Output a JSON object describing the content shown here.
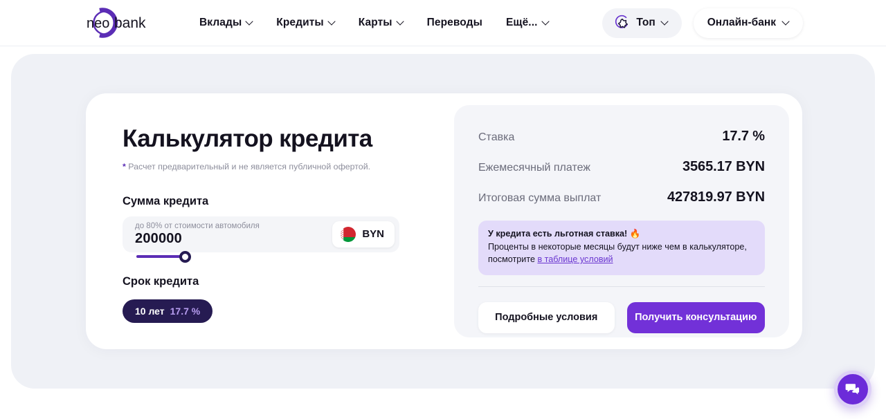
{
  "header": {
    "logo": {
      "name": "neo bank",
      "part1": "neo",
      "part2": "bank"
    },
    "nav": [
      {
        "label": "Вклады",
        "has_chevron": true
      },
      {
        "label": "Кредиты",
        "has_chevron": true
      },
      {
        "label": "Карты",
        "has_chevron": true
      },
      {
        "label": "Переводы",
        "has_chevron": false
      },
      {
        "label": "Ещё...",
        "has_chevron": true
      }
    ],
    "top_button": {
      "label": "Топ",
      "icon": "star-icon"
    },
    "online_bank_button": {
      "label": "Онлайн-банк",
      "icon": "chevron-down-icon"
    }
  },
  "calculator": {
    "title": "Калькулятор кредита",
    "disclaimer_star": "*",
    "disclaimer": "Расчет предварительный и не является публичной офертой.",
    "amount": {
      "label": "Сумма кредита",
      "hint": "до 80% от стоимости автомобиля",
      "value": "200000",
      "currency": "BYN",
      "currency_flag": "belarus-flag-icon",
      "slider_percent": 18
    },
    "term": {
      "label": "Срок кредита",
      "value": "10 лет",
      "rate": "17.7 %"
    }
  },
  "results": {
    "rows": [
      {
        "label": "Ставка",
        "value": "17.7 %"
      },
      {
        "label": "Ежемесячный платеж",
        "value": "3565.17 BYN"
      },
      {
        "label": "Итоговая сумма выплат",
        "value": "427819.97 BYN"
      }
    ],
    "notice": {
      "title": "У кредита есть льготная ставка! 🔥",
      "text": "Проценты в некоторые месяцы будут ниже чем в калькуляторе, посмотрите ",
      "link": "в таблице условий"
    },
    "buttons": {
      "secondary": "Подробные условия",
      "primary": "Получить консультацию"
    }
  },
  "chat": {
    "icon": "chat-bubble-icon",
    "label": "Чат"
  },
  "colors": {
    "brand_purple": "#5b2db5",
    "primary_button": "#7231d8",
    "dark_navy": "#261b52",
    "notice_bg": "#e3dbfa",
    "panel_bg": "#f4f5f9",
    "shell_bg": "#eff1f6"
  }
}
